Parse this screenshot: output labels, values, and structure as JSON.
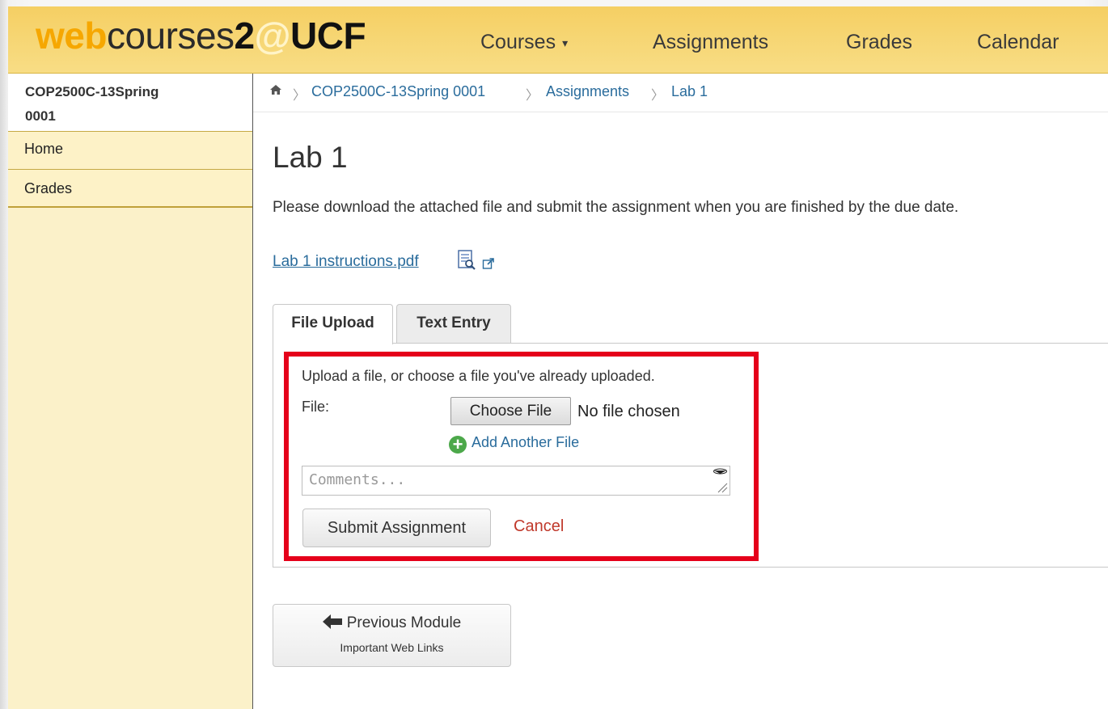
{
  "header": {
    "logo": {
      "web": "web",
      "courses": "courses",
      "two": "2",
      "at": "@",
      "ucf": "UCF"
    },
    "nav": [
      {
        "label": "Courses",
        "caret": "▾"
      },
      {
        "label": "Assignments"
      },
      {
        "label": "Grades"
      },
      {
        "label": "Calendar"
      }
    ]
  },
  "sidebar": {
    "course_title_line1": "COP2500C-13Spring",
    "course_title_line2": "0001",
    "items": [
      {
        "label": "Home"
      },
      {
        "label": "Grades"
      }
    ]
  },
  "breadcrumb": {
    "home_icon": "home-icon",
    "items": [
      "COP2500C-13Spring 0001",
      "Assignments",
      "Lab 1"
    ]
  },
  "assignment": {
    "title": "Lab 1",
    "description": "Please download the attached file and submit the assignment when you are finished by the due date.",
    "attachment": "Lab 1 instructions.pdf"
  },
  "tabs": [
    {
      "label": "File Upload",
      "active": true
    },
    {
      "label": "Text Entry",
      "active": false
    }
  ],
  "upload": {
    "help": "Upload a file, or choose a file you've already uploaded.",
    "file_label": "File:",
    "choose_button": "Choose File",
    "no_file": "No file chosen",
    "add_another": "Add Another File",
    "comments_placeholder": "Comments...",
    "submit": "Submit Assignment",
    "cancel": "Cancel"
  },
  "prev_module": {
    "label": "Previous Module",
    "sub": "Important Web Links"
  },
  "colors": {
    "header_gold": "#f5cf63",
    "link_blue": "#2a6c9c",
    "highlight_red": "#e5001a",
    "cancel_red": "#c0392b"
  }
}
